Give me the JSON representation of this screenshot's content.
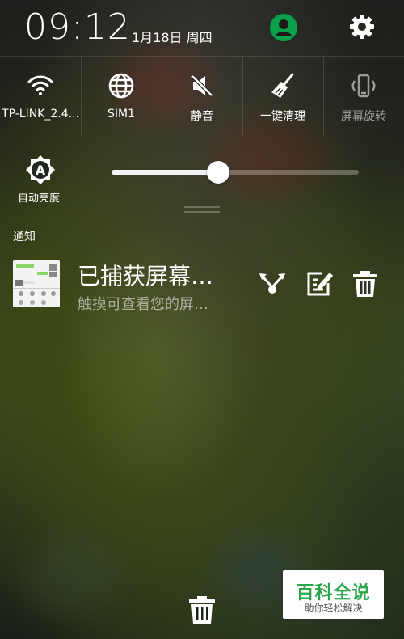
{
  "status_bar": {
    "time": "09:12",
    "date": "1月18日 周四",
    "avatar_icon": "user-avatar-icon",
    "settings_icon": "gear-icon"
  },
  "quick_settings": [
    {
      "label": "TP-LINK_2.4...",
      "icon": "wifi-icon"
    },
    {
      "label": "SIM1",
      "icon": "globe-icon"
    },
    {
      "label": "静音",
      "icon": "mute-icon"
    },
    {
      "label": "一键清理",
      "icon": "broom-icon"
    },
    {
      "label": "屏幕旋转",
      "icon": "rotate-screen-icon"
    }
  ],
  "brightness": {
    "auto_label": "自动亮度",
    "level": 0.43
  },
  "notifications": {
    "title": "通知",
    "items": [
      {
        "title": "已捕获屏幕…",
        "subtitle": "触摸可查看您的屏…"
      }
    ]
  },
  "colors": {
    "accent_green": "#0aa04a",
    "watermark_green": "#2aa74b"
  },
  "watermark": {
    "line1": "百科全说",
    "line2": "助你轻松解决"
  }
}
